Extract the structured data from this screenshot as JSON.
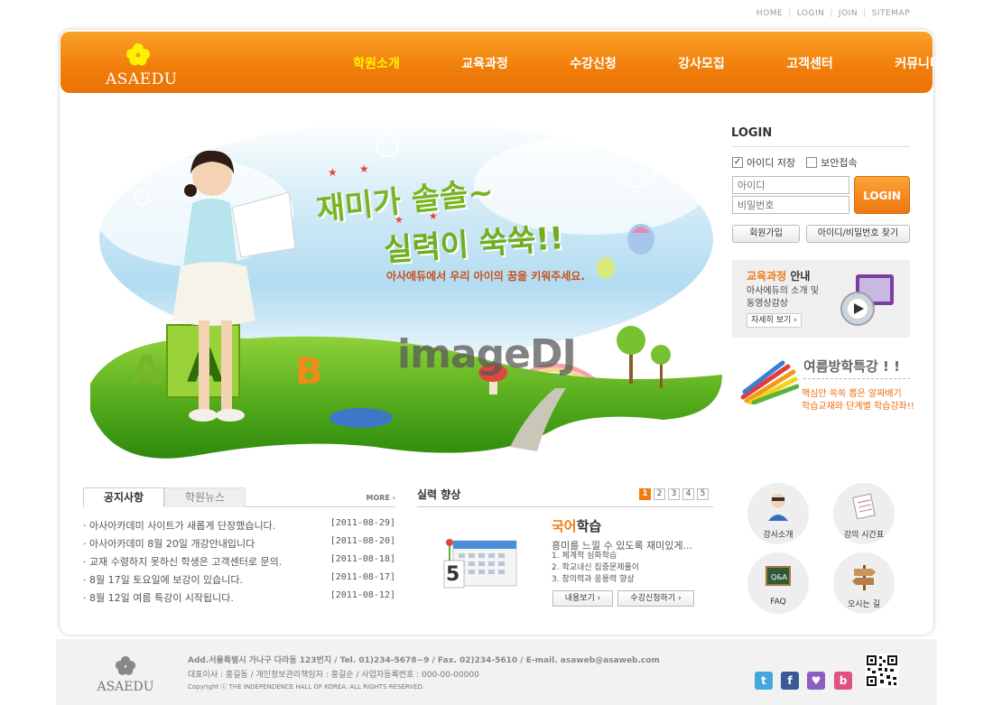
{
  "utility_links": [
    "HOME",
    "LOGIN",
    "JOIN",
    "SITEMAP"
  ],
  "brand": {
    "name": "ASAEDU",
    "accent": "#f07d0a",
    "highlight": "#fff200"
  },
  "nav": [
    "학원소개",
    "교육과정",
    "수강신청",
    "강사모집",
    "고객센터",
    "커뮤니티"
  ],
  "hero": {
    "title1": "재미가 솔솔~",
    "title2": "실력이 쑥쑥!!",
    "subtitle": "아사에듀에서 우리 아이의 꿈을 키워주세요.",
    "watermark": "imageDJ"
  },
  "login": {
    "title": "LOGIN",
    "save_id": "아이디 저장",
    "secure": "보안접속",
    "id_placeholder": "아이디",
    "pw_placeholder": "비밀번호",
    "button": "LOGIN",
    "join": "회원가입",
    "find": "아이디/비밀번호 찾기"
  },
  "course": {
    "title_hl": "교육과정",
    "title_rest": " 안내",
    "desc1": "아사에듀의 소개 및",
    "desc2": "동영상감상",
    "more": "자세히 보기 ›"
  },
  "summer": {
    "title": "여름방학특강 ! !",
    "desc1": "핵심만 쏙쏙 뽑은 알짜배기",
    "desc2": "학습교재와 단계별 학습강좌!!"
  },
  "notice": {
    "tabs": [
      "공지사항",
      "학원뉴스"
    ],
    "more": "MORE ›",
    "items": [
      {
        "title": "· 아사아카데미 사이트가 새롭게 단장했습니다.",
        "date": "[2011-08-29]"
      },
      {
        "title": "· 아사아카데미 8월 20일 개강안내입니다",
        "date": "[2011-08-20]"
      },
      {
        "title": "· 교재 수령하지 못하신 학생은 고객센터로 문의.",
        "date": "[2011-08-18]"
      },
      {
        "title": "· 8월 17일 토요일에 보강이 있습니다.",
        "date": "[2011-08-17]"
      },
      {
        "title": "· 8월 12일 여름 특강이 시작됩니다.",
        "date": "[2011-08-12]"
      }
    ]
  },
  "skill": {
    "title": "실력 향상",
    "pages": [
      "1",
      "2",
      "3",
      "4",
      "5"
    ],
    "calendar_number": "5",
    "heading_hl": "국어",
    "heading_rest": "학습",
    "desc": "흥미를 느낄 수 있도록 재미있게...",
    "list": [
      "1. 체계적 심화학습",
      "2. 학교내신 집중문제풀이",
      "3. 창의력과 응용력 향상"
    ],
    "btn_view": "내용보기 ›",
    "btn_apply": "수강신청하기 ›"
  },
  "quick": [
    "강사소개",
    "강의 시간표",
    "FAQ",
    "오시는 길"
  ],
  "footer": {
    "line1": "Add.서울특별시 가나구 다라동 123번지  / Tel. 01)234-5678~9  / Fax. 02)234-5610  / E-mail. asaweb@asaweb.com",
    "line2": "대표이사 : 홍길동 / 개인정보관리책임자 : 홍길순 / 사업자등록번호 : 000-00-00000",
    "line3": "Copyright ⓒ THE INDEPENDENCE HALL OF KOREA. ALL RIGHTS RESERVED.",
    "social": [
      "twitter-icon",
      "facebook-icon",
      "messenger-icon",
      "blog-icon"
    ]
  }
}
